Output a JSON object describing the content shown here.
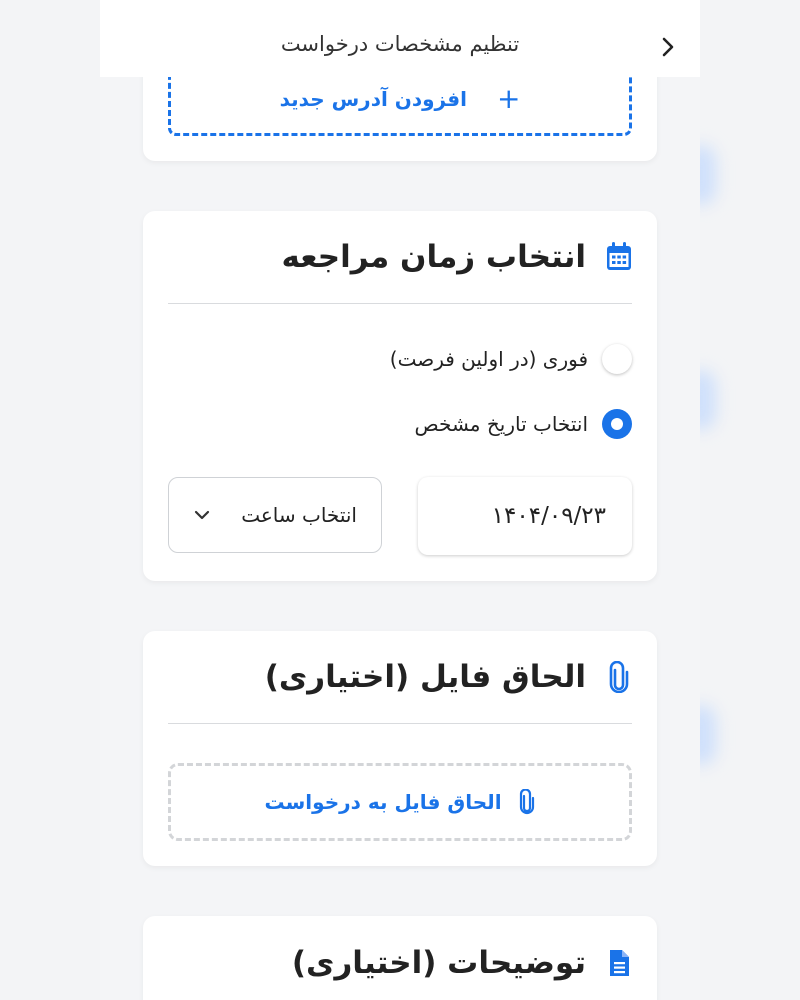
{
  "header": {
    "title": "تنظیم مشخصات درخواست"
  },
  "address": {
    "add_label": "افزودن آدرس جدید",
    "add_glyph": "+"
  },
  "visit_time": {
    "title": "انتخاب زمان مراجعه",
    "options": [
      {
        "label": "فوری (در اولین فرصت)",
        "selected": false
      },
      {
        "label": "انتخاب تاریخ مشخص",
        "selected": true
      }
    ],
    "date_value": "۱۴۰۴/۰۹/۲۳",
    "time_placeholder": "انتخاب ساعت"
  },
  "attachment": {
    "title": "الحاق فایل (اختیاری)",
    "button_label": "الحاق فایل به درخواست"
  },
  "notes": {
    "title": "توضیحات (اختیاری)"
  },
  "colors": {
    "accent": "#1a73e8",
    "card": "#ffffff",
    "background": "#f4f5f7"
  }
}
